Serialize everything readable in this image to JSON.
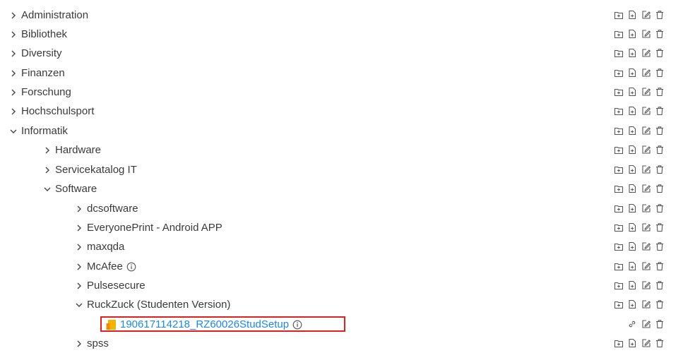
{
  "tree": {
    "items": [
      {
        "label": "Administration",
        "expanded": false
      },
      {
        "label": "Bibliothek",
        "expanded": false
      },
      {
        "label": "Diversity",
        "expanded": false
      },
      {
        "label": "Finanzen",
        "expanded": false
      },
      {
        "label": "Forschung",
        "expanded": false
      },
      {
        "label": "Hochschulsport",
        "expanded": false
      },
      {
        "label": "Informatik",
        "expanded": true
      },
      {
        "label": "Hardware",
        "expanded": false
      },
      {
        "label": "Servicekatalog IT",
        "expanded": false
      },
      {
        "label": "Software",
        "expanded": true
      },
      {
        "label": "dcsoftware",
        "expanded": false
      },
      {
        "label": "EveryonePrint - Android APP",
        "expanded": false
      },
      {
        "label": "maxqda",
        "expanded": false
      },
      {
        "label": "McAfee",
        "expanded": false,
        "info_icon": "info-icon"
      },
      {
        "label": "Pulsesecure",
        "expanded": false
      },
      {
        "label": "RuckZuck (Studenten Version)",
        "expanded": true
      },
      {
        "label": "190617114218_RZ60026StudSetup",
        "type": "file",
        "info_icon": "info-icon",
        "highlighted": true
      },
      {
        "label": "spss",
        "expanded": false
      }
    ]
  },
  "icons": {
    "folder_actions": [
      "add-folder-icon",
      "add-file-icon",
      "edit-icon",
      "delete-icon"
    ],
    "file_actions": [
      "link-icon",
      "edit-icon",
      "delete-icon"
    ],
    "collapsed": "chevron-right-icon",
    "expanded": "chevron-down-icon",
    "file": "file-icon"
  },
  "colors": {
    "text": "#3a3a3a",
    "link": "#1e88e5",
    "highlight_border": "#e11f1f",
    "file_icon": "#f5b301"
  }
}
